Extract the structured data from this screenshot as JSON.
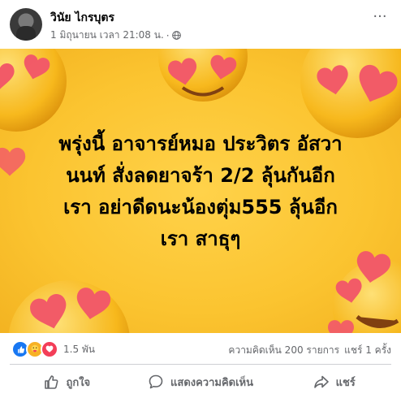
{
  "post": {
    "author": "วินัย ไกรบุตร",
    "timestamp": "1 มิถุนายน เวลา 21:08 น.",
    "separator": "·",
    "privacy_icon": "globe-icon",
    "more_label": "···",
    "text": "พรุ่งนี้ อาจารย์หมอ ประวิตร อัสวานนท์ สั่งลดยาจร้า 2/2 ลุ้นกันอีกเรา อย่าดีดนะน้องตุ่ม555 ลุ้นอีกเรา สาธุๆ",
    "text_lines": [
      "พรุ่งนี้ อาจารย์หมอ ประวิตร อัสวา",
      "นนท์ สั่งลดยาจร้า 2/2 ลุ้นกันอีก",
      "เรา อย่าดีดนะน้องตุ่ม555 ลุ้นอีก",
      "เรา สาธุๆ"
    ],
    "background_color": "#fbc430"
  },
  "stats": {
    "reaction_icons": [
      "like-icon",
      "care-icon",
      "love-icon"
    ],
    "reaction_count": "1.5 พัน",
    "comments": "ความคิดเห็น 200 รายการ",
    "shares": "แชร์ 1 ครั้ง"
  },
  "actions": {
    "like": "ถูกใจ",
    "comment": "แสดงความคิดเห็น",
    "share": "แชร์"
  },
  "colors": {
    "secondary_text": "#65676b",
    "like_blue": "#1877f2",
    "love_red": "#f33e58",
    "care_yellow": "#f7b125"
  }
}
